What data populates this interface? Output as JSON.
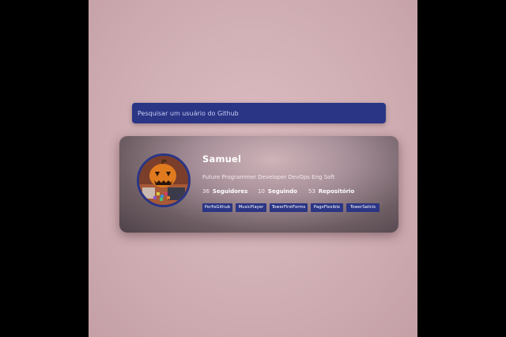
{
  "search": {
    "placeholder": "Pesquisar um usuário do Github"
  },
  "profile": {
    "name": "Samuel",
    "bio": "Future Programmer Developer DevOps Eng Soft",
    "stats": {
      "followers_count": "36",
      "followers_label": "Seguidores",
      "following_count": "10",
      "following_label": "Seguindo",
      "repos_count": "53",
      "repos_label": "Repositório"
    },
    "repos": [
      "PerfisGithub",
      "MusicPlayer",
      "TowerFirstForms",
      "PageFlexible",
      "TowerSalicis"
    ]
  },
  "colors": {
    "accent": "#2a3585",
    "page_background": "#d2b1b6",
    "side_bars": "#000000"
  },
  "icons": {
    "avatar": "pumpkin-head-avatar"
  }
}
